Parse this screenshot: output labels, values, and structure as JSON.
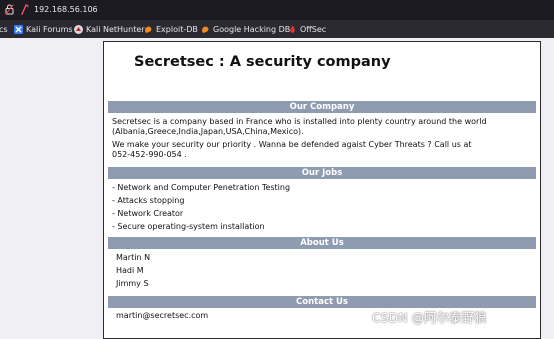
{
  "browser": {
    "url": "192.168.56.106",
    "bookmarks": [
      {
        "label": "cs",
        "icon": "none"
      },
      {
        "label": "Kali Forums",
        "icon": "kali-forums-icon"
      },
      {
        "label": "Kali NetHunter",
        "icon": "kali-nethunter-icon"
      },
      {
        "label": "Exploit-DB",
        "icon": "exploit-db-icon"
      },
      {
        "label": "Google Hacking DB",
        "icon": "ghdb-icon"
      },
      {
        "label": "OffSec",
        "icon": "offsec-icon"
      }
    ]
  },
  "page": {
    "title": "Secretsec : A security company",
    "company": {
      "heading": "Our Company",
      "line1": "Secretsec is a company based in France who is installed into plenty country around the world",
      "line2": "(Albania,Greece,India,Japan,USA,China,Mexico).",
      "line3": "We make your security our priority . Wanna be defended agaist Cyber Threats ? Call us at",
      "line4": "052-452-990-054 ."
    },
    "jobs": {
      "heading": "Our Jobs",
      "items": [
        "- Network and Computer Penetration Testing",
        "- Attacks stopping",
        "- Network Creator",
        "- Secure operating-system installation"
      ]
    },
    "about": {
      "heading": "About Us",
      "members": [
        "Martin N",
        "Hadi M",
        "Jimmy S"
      ]
    },
    "contact": {
      "heading": "Contact Us",
      "email": "martin@secretsec.com"
    }
  },
  "watermark": "CSDN @阿尔泰野狼",
  "colors": {
    "banner": "#8e9bb0",
    "toolbar": "#1d1b22",
    "bookmarks_bar": "#2b2a33",
    "page_bg": "#f0f0f4"
  }
}
